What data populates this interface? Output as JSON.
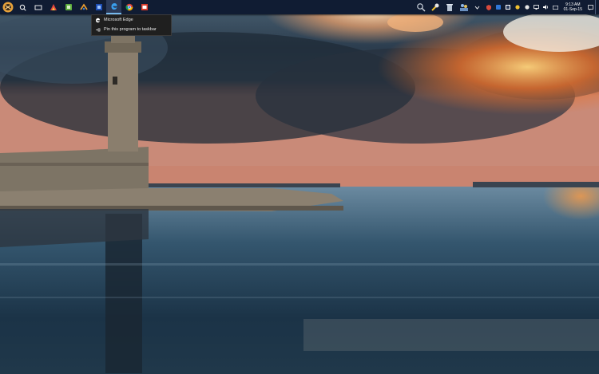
{
  "desktop": {
    "wallpaper": "lighthouse-harbor-sunset"
  },
  "taskbar": {
    "background": "#101c33",
    "accent": "#76b9ed",
    "pinned_apps": [
      {
        "name": "start-button-icon"
      },
      {
        "name": "search-icon"
      },
      {
        "name": "task-view-icon"
      },
      {
        "name": "app-icon-1"
      },
      {
        "name": "app-icon-2"
      },
      {
        "name": "app-icon-3"
      },
      {
        "name": "app-icon-4"
      },
      {
        "name": "microsoft-edge-icon",
        "active": true
      },
      {
        "name": "chrome-icon"
      },
      {
        "name": "app-icon-red"
      }
    ],
    "tray": {
      "clock_time": "9:13 AM",
      "clock_date": "01-Sep-15"
    }
  },
  "jumplist": {
    "items": [
      {
        "label": "Microsoft Edge",
        "icon": "edge-icon"
      },
      {
        "label": "Pin this program to taskbar",
        "icon": "pin-icon"
      }
    ]
  }
}
